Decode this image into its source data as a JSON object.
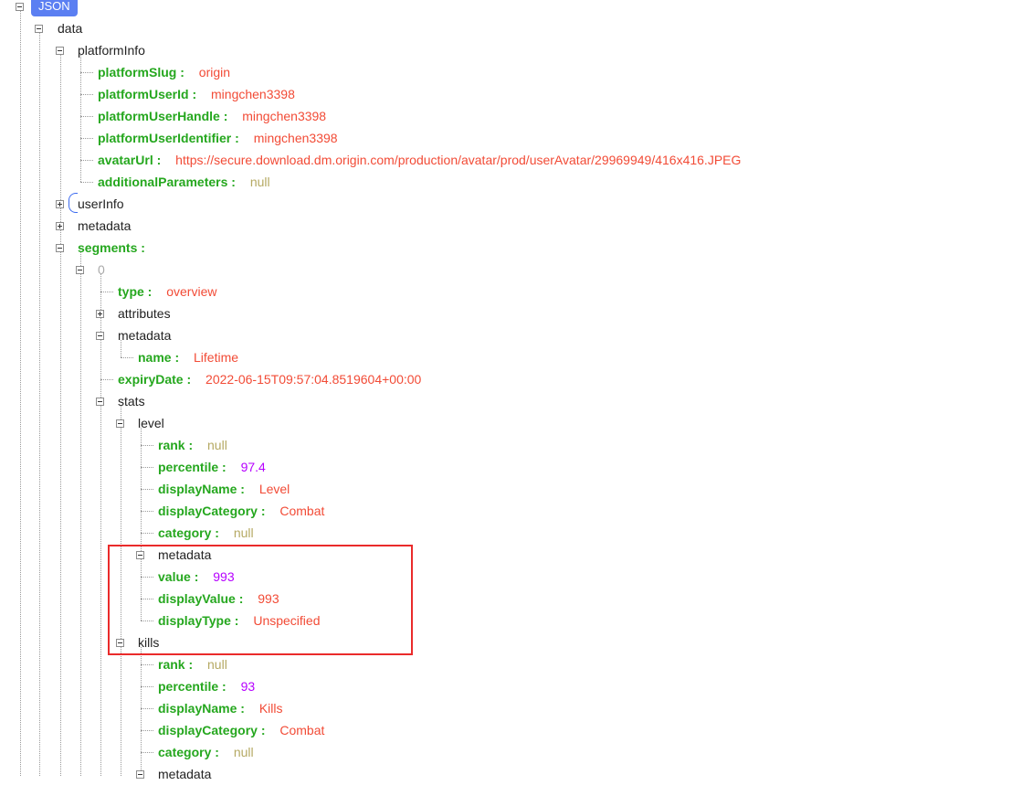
{
  "root_label": "JSON",
  "tree": {
    "data": "data",
    "platformInfo": {
      "label": "platformInfo",
      "fields": [
        {
          "key": "platformSlug :",
          "value": "origin",
          "type": "str"
        },
        {
          "key": "platformUserId :",
          "value": "mingchen3398",
          "type": "str"
        },
        {
          "key": "platformUserHandle :",
          "value": "mingchen3398",
          "type": "str"
        },
        {
          "key": "platformUserIdentifier :",
          "value": "mingchen3398",
          "type": "str"
        },
        {
          "key": "avatarUrl :",
          "value": "https://secure.download.dm.origin.com/production/avatar/prod/userAvatar/29969949/416x416.JPEG",
          "type": "str"
        },
        {
          "key": "additionalParameters :",
          "value": "null",
          "type": "nul"
        }
      ]
    },
    "userInfo": "userInfo",
    "metadata": "metadata",
    "segments": "segments :",
    "seg0": {
      "index": "0",
      "type": {
        "key": "type :",
        "value": "overview"
      },
      "attributes": "attributes",
      "metadata": "metadata",
      "name": {
        "key": "name :",
        "value": "Lifetime"
      },
      "expiryDate": {
        "key": "expiryDate :",
        "value": "2022-06-15T09:57:04.8519604+00:00"
      },
      "stats": "stats"
    },
    "level": {
      "label": "level",
      "rank": {
        "key": "rank :",
        "value": "null"
      },
      "percentile": {
        "key": "percentile :",
        "value": "97.4"
      },
      "displayName": {
        "key": "displayName :",
        "value": "Level"
      },
      "displayCategory": {
        "key": "displayCategory :",
        "value": "Combat"
      },
      "category": {
        "key": "category :",
        "value": "null"
      },
      "metadata": "metadata",
      "value": {
        "key": "value :",
        "value": "993"
      },
      "displayValue": {
        "key": "displayValue :",
        "value": "993"
      },
      "displayType": {
        "key": "displayType :",
        "value": "Unspecified"
      }
    },
    "kills": {
      "label": "kills",
      "rank": {
        "key": "rank :",
        "value": "null"
      },
      "percentile": {
        "key": "percentile :",
        "value": "93"
      },
      "displayName": {
        "key": "displayName :",
        "value": "Kills"
      },
      "displayCategory": {
        "key": "displayCategory :",
        "value": "Combat"
      },
      "category": {
        "key": "category :",
        "value": "null"
      },
      "metadata": "metadata"
    }
  },
  "colors": {
    "key": "#25a71e",
    "string": "#f24b36",
    "number": "#b600ff",
    "null": "#b5a963",
    "highlight": "#ea2b2b",
    "badge": "#5b7ff2"
  }
}
